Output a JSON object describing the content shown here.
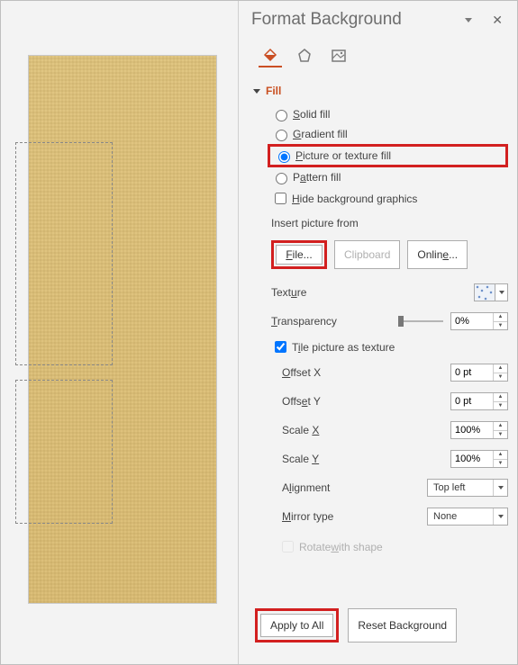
{
  "panel": {
    "title": "Format Background",
    "section_fill": "Fill",
    "radios": {
      "solid": "Solid fill",
      "gradient": "Gradient fill",
      "picture": "Picture or texture fill",
      "pattern": "Pattern fill"
    },
    "hide_bg": "Hide background graphics",
    "insert_from": "Insert picture from",
    "buttons": {
      "file": "File...",
      "clipboard": "Clipboard",
      "online": "Online..."
    },
    "texture_label": "Texture",
    "transparency_label": "Transparency",
    "transparency_value": "0%",
    "tile_label": "Tile picture as texture",
    "offset_x_label": "Offset X",
    "offset_x_value": "0 pt",
    "offset_y_label": "Offset Y",
    "offset_y_value": "0 pt",
    "scale_x_label": "Scale X",
    "scale_x_value": "100%",
    "scale_y_label": "Scale Y",
    "scale_y_value": "100%",
    "alignment_label": "Alignment",
    "alignment_value": "Top left",
    "mirror_label": "Mirror type",
    "mirror_value": "None",
    "rotate_label": "Rotate with shape",
    "footer": {
      "apply_all": "Apply to All",
      "reset": "Reset Background"
    }
  }
}
